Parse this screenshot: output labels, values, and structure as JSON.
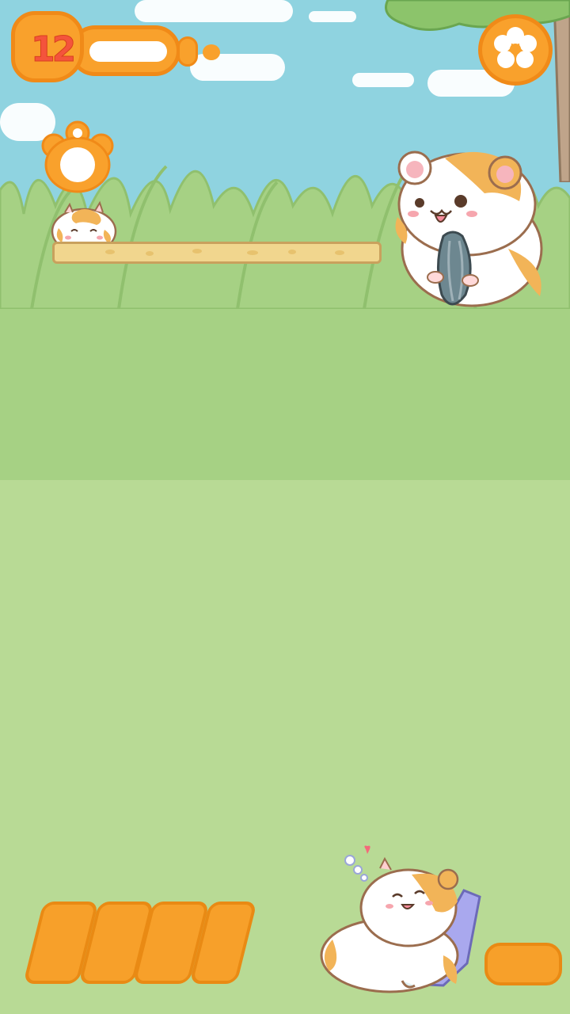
{
  "hud": {
    "level_number": "12",
    "level_progress_fraction": 1.0,
    "settings_icon": "flower-gear-icon",
    "paw_icon": "paw-icon"
  },
  "colors": {
    "sky": "#8fd3e0",
    "meadow_far": "#a6d184",
    "meadow_near": "#b8da95",
    "hud_orange": "#f9a12c",
    "hud_orange_border": "#f08a18",
    "level_number_red": "#f4543c",
    "plank": "#f1d68e"
  },
  "characters": {
    "small_hamster": "small-hamster",
    "big_hamster": "big-hamster-with-seed",
    "sleepy_hamster": "sleepy-hamster-on-pillow",
    "seed_icon": "sunflower-seed-icon"
  },
  "tray": {
    "slot_count": 4,
    "action_button_icon": "blank-orange-button"
  }
}
